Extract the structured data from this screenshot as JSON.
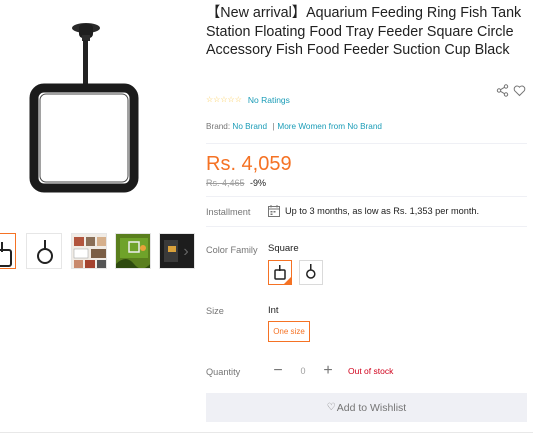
{
  "product": {
    "title": "【New arrival】Aquarium Feeding Ring Fish Tank Station Floating Food Tray Feeder Square Circle Accessory Fish Food Feeder Suction Cup Black",
    "rating": {
      "stars": "☆☆☆☆☆",
      "text": "No Ratings"
    },
    "brand": {
      "label": "Brand:",
      "name": "No Brand",
      "separator": "|",
      "more": "More Women from No Brand"
    },
    "price": {
      "current": "Rs. 4,059",
      "original": "Rs. 4,465",
      "discount": "-9%"
    },
    "installment": {
      "label": "Installment",
      "text": "Up to 3 months, as low as Rs. 1,353 per month."
    },
    "color": {
      "label": "Color Family",
      "selected": "Square",
      "options": [
        "Square",
        "Circle"
      ]
    },
    "size": {
      "label": "Size",
      "value": "Int",
      "option": "One size"
    },
    "quantity": {
      "label": "Quantity",
      "minus": "−",
      "value": "0",
      "plus": "+",
      "stock_status": "Out of stock"
    },
    "wishlist": {
      "icon": "♡",
      "label": "Add to Wishlist"
    }
  },
  "gallery": {
    "next_label": "›",
    "thumbnails": [
      "square-feeder",
      "circle-feeder",
      "collage",
      "aquarium-scene",
      "dark-photo"
    ]
  },
  "colors": {
    "accent": "#f57224",
    "link": "#1a9cb7",
    "error": "#d0011b",
    "muted": "#757575"
  }
}
